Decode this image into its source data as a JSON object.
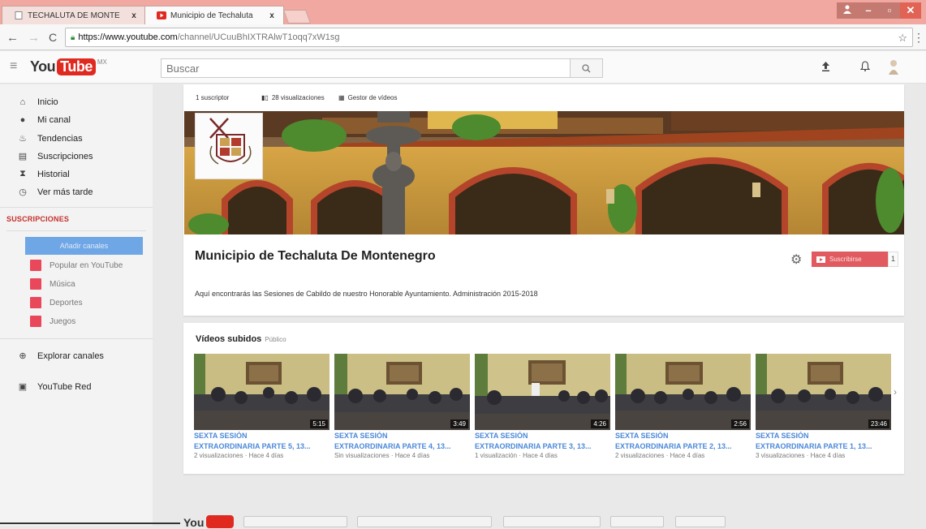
{
  "browser": {
    "tabs": [
      {
        "title": "TECHALUTA DE MONTE",
        "close": "x"
      },
      {
        "title": "Municipio de Techaluta",
        "close": "x"
      }
    ],
    "url_host": "https://www.youtube.com",
    "url_path": "/channel/UCuuBhIXTRAlwT1oqq7xW1sg"
  },
  "header": {
    "logo_you": "You",
    "logo_tube": "Tube",
    "logo_region": "MX",
    "search_placeholder": "Buscar"
  },
  "sidebar": {
    "items": [
      {
        "label": "Inicio",
        "icon": "home-icon"
      },
      {
        "label": "Mi canal",
        "icon": "person-icon"
      },
      {
        "label": "Tendencias",
        "icon": "flame-icon"
      },
      {
        "label": "Suscripciones",
        "icon": "subscriptions-icon"
      },
      {
        "label": "Historial",
        "icon": "hourglass-icon"
      },
      {
        "label": "Ver más tarde",
        "icon": "clock-icon"
      }
    ],
    "subscriptions_heading": "SUSCRIPCIONES",
    "add_channels": "Añadir canales",
    "subscriptions": [
      {
        "label": "Popular en YouTube",
        "color": "#e9485a"
      },
      {
        "label": "Música",
        "color": "#e9485a"
      },
      {
        "label": "Deportes",
        "color": "#e9485a"
      },
      {
        "label": "Juegos",
        "color": "#e9485a"
      }
    ],
    "explore": "Explorar canales",
    "red": "YouTube Red"
  },
  "channel": {
    "subscribers": "1 suscriptor",
    "views": "28 visualizaciones",
    "manager": "Gestor de vídeos",
    "title": "Municipio de Techaluta De Montenegro",
    "subscribe": "Suscribirse",
    "subscribe_count": "1",
    "description": "Aquí encontrarás las Sesiones de Cabildo de nuestro Honorable Ayuntamiento. Administración 2015-2018"
  },
  "uploads": {
    "heading": "Vídeos subidos",
    "visibility": "Público",
    "videos": [
      {
        "duration": "5:15",
        "title1": "SEXTA SESIÓN",
        "title2": "EXTRAORDINARIA PARTE 5, 13...",
        "meta": "2 visualizaciones · Hace 4 días"
      },
      {
        "duration": "3:49",
        "title1": "SEXTA SESIÓN",
        "title2": "EXTRAORDINARIA PARTE 4, 13...",
        "meta": "Sin visualizaciones · Hace 4 días"
      },
      {
        "duration": "4:26",
        "title1": "SEXTA SESIÓN",
        "title2": "EXTRAORDINARIA PARTE 3, 13...",
        "meta": "1 visualización · Hace 4 días"
      },
      {
        "duration": "2:56",
        "title1": "SEXTA SESIÓN",
        "title2": "EXTRAORDINARIA PARTE 2, 13...",
        "meta": "2 visualizaciones · Hace 4 días"
      },
      {
        "duration": "23:46",
        "title1": "SEXTA SESIÓN",
        "title2": "EXTRAORDINARIA PARTE 1, 13...",
        "meta": "3 visualizaciones · Hace 4 días"
      }
    ]
  },
  "footer": {
    "logo_you": "You"
  }
}
